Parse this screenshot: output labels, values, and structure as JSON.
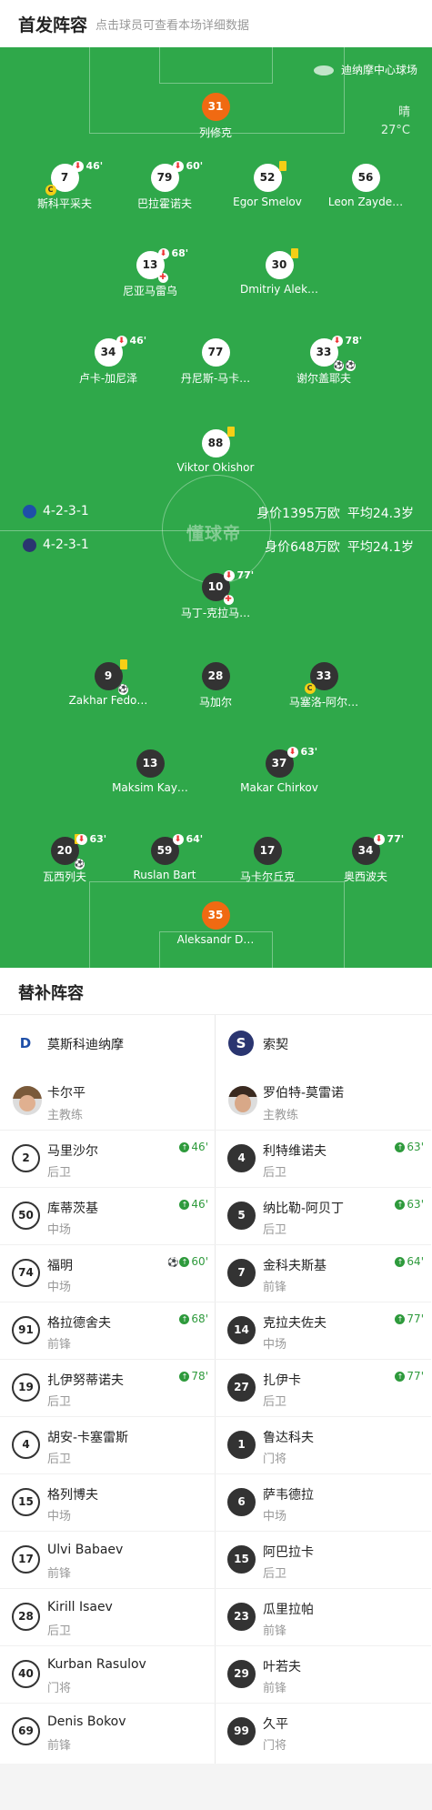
{
  "header": {
    "title": "首发阵容",
    "subtitle": "点击球员可查看本场详细数据"
  },
  "venue": "迪纳摩中心球场",
  "weather": {
    "cond": "晴",
    "temp": "27°C"
  },
  "watermark": "懂球帝",
  "home": {
    "formation": "4-2-3-1",
    "value": "身价1395万欧",
    "age": "平均24.3岁"
  },
  "away": {
    "formation": "4-2-3-1",
    "value": "身价648万欧",
    "age": "平均24.1岁"
  },
  "home_players": [
    {
      "num": "31",
      "name": "列修克",
      "sub": ""
    },
    {
      "num": "7",
      "name": "斯科平采夫",
      "sub": "46'"
    },
    {
      "num": "79",
      "name": "巴拉霍诺夫",
      "sub": "60'"
    },
    {
      "num": "52",
      "name": "Egor Smelov",
      "sub": ""
    },
    {
      "num": "56",
      "name": "Leon Zayde…",
      "sub": ""
    },
    {
      "num": "13",
      "name": "尼亚马雷乌",
      "sub": "68'"
    },
    {
      "num": "30",
      "name": "Dmitriy Alek…",
      "sub": ""
    },
    {
      "num": "34",
      "name": "卢卡-加尼泽",
      "sub": "46'"
    },
    {
      "num": "77",
      "name": "丹尼斯-马卡…",
      "sub": ""
    },
    {
      "num": "33",
      "name": "谢尔盖耶夫",
      "sub": "78'"
    },
    {
      "num": "88",
      "name": "Viktor Okishor",
      "sub": ""
    }
  ],
  "away_players": [
    {
      "num": "10",
      "name": "马丁-克拉马…",
      "sub": "77'"
    },
    {
      "num": "9",
      "name": "Zakhar Fedo…",
      "sub": ""
    },
    {
      "num": "28",
      "name": "马加尔",
      "sub": ""
    },
    {
      "num": "33",
      "name": "马塞洛-阿尔…",
      "sub": ""
    },
    {
      "num": "13",
      "name": "Maksim Kay…",
      "sub": ""
    },
    {
      "num": "37",
      "name": "Makar Chirkov",
      "sub": "63'"
    },
    {
      "num": "20",
      "name": "瓦西列夫",
      "sub": "63'"
    },
    {
      "num": "59",
      "name": "Ruslan Bart",
      "sub": "64'"
    },
    {
      "num": "17",
      "name": "马卡尔丘克",
      "sub": ""
    },
    {
      "num": "34",
      "name": "奥西波夫",
      "sub": "77'"
    },
    {
      "num": "35",
      "name": "Aleksandr D…",
      "sub": ""
    }
  ],
  "bench": {
    "title": "替补阵容",
    "home_team": "莫斯科迪纳摩",
    "away_team": "索契",
    "home_coach": {
      "name": "卡尔平",
      "role": "主教练"
    },
    "away_coach": {
      "name": "罗伯特-莫雷诺",
      "role": "主教练"
    },
    "home_subs": [
      {
        "num": "2",
        "name": "马里沙尔",
        "pos": "后卫",
        "time": "46'"
      },
      {
        "num": "50",
        "name": "库蒂茨基",
        "pos": "中场",
        "time": "46'"
      },
      {
        "num": "74",
        "name": "福明",
        "pos": "中场",
        "time": "60'"
      },
      {
        "num": "91",
        "name": "格拉德舍夫",
        "pos": "前锋",
        "time": "68'"
      },
      {
        "num": "19",
        "name": "扎伊努蒂诺夫",
        "pos": "后卫",
        "time": "78'"
      },
      {
        "num": "4",
        "name": "胡安-卡塞雷斯",
        "pos": "后卫",
        "time": ""
      },
      {
        "num": "15",
        "name": "格列博夫",
        "pos": "中场",
        "time": ""
      },
      {
        "num": "17",
        "name": "Ulvi Babaev",
        "pos": "前锋",
        "time": ""
      },
      {
        "num": "28",
        "name": "Kirill Isaev",
        "pos": "后卫",
        "time": ""
      },
      {
        "num": "40",
        "name": "Kurban Rasulov",
        "pos": "门将",
        "time": ""
      },
      {
        "num": "69",
        "name": "Denis Bokov",
        "pos": "前锋",
        "time": ""
      }
    ],
    "away_subs": [
      {
        "num": "4",
        "name": "利特维诺夫",
        "pos": "后卫",
        "time": "63'"
      },
      {
        "num": "5",
        "name": "纳比勒-阿贝丁",
        "pos": "后卫",
        "time": "63'"
      },
      {
        "num": "7",
        "name": "金科夫斯基",
        "pos": "前锋",
        "time": "64'"
      },
      {
        "num": "14",
        "name": "克拉夫佐夫",
        "pos": "中场",
        "time": "77'"
      },
      {
        "num": "27",
        "name": "扎伊卡",
        "pos": "后卫",
        "time": "77'"
      },
      {
        "num": "1",
        "name": "鲁达科夫",
        "pos": "门将",
        "time": ""
      },
      {
        "num": "6",
        "name": "萨韦德拉",
        "pos": "中场",
        "time": ""
      },
      {
        "num": "15",
        "name": "阿巴拉卡",
        "pos": "后卫",
        "time": ""
      },
      {
        "num": "23",
        "name": "瓜里拉帕",
        "pos": "前锋",
        "time": ""
      },
      {
        "num": "29",
        "name": "叶若夫",
        "pos": "前锋",
        "time": ""
      },
      {
        "num": "99",
        "name": "久平",
        "pos": "门将",
        "time": ""
      }
    ]
  },
  "colors": {
    "pitch": "#2fa84a",
    "keeper": "#f06a12",
    "sub_green": "#2e9a3c",
    "yellow_card": "#f5cf16"
  }
}
